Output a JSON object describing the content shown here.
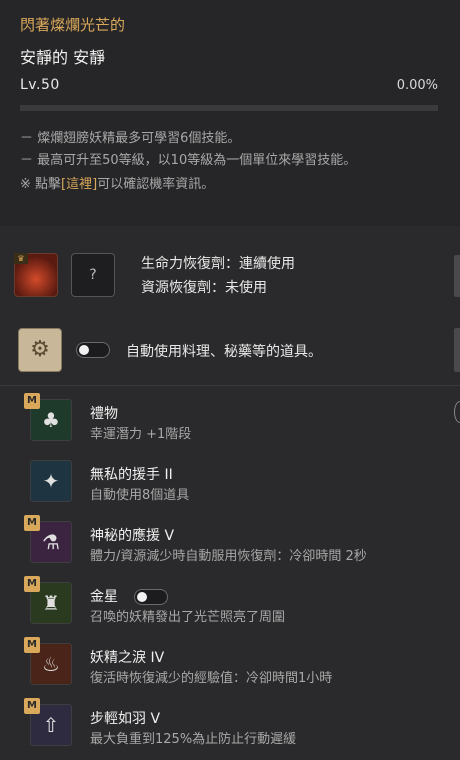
{
  "header": {
    "rank_label": "閃著燦爛光芒的",
    "fairy_name": "安靜的 安靜",
    "level": "Lv.50",
    "exp_percent_text": "0.00%",
    "exp_progress": 0.0
  },
  "info_lines": [
    "－ 燦爛翅膀妖精最多可學習6個技能。",
    "－ 最高可升至50等級，以10等級為一個單位來學習技能。"
  ],
  "info_click": {
    "prefix": "※ 點擊",
    "link": "[這裡]",
    "suffix": "可以確認機率資訊。"
  },
  "potion": {
    "unknown_slot": "?",
    "hp_line": "生命力恢復劑：連續使用",
    "resource_line": "資源恢復劑：未使用"
  },
  "auto_use": {
    "label": "自動使用料理、秘藥等的道具。",
    "enabled": false
  },
  "skills": [
    {
      "badge": "M",
      "icon": "clover-icon",
      "title": "禮物",
      "desc": "幸運潛力 +1階段",
      "color": "#1e3a2a"
    },
    {
      "badge": "",
      "icon": "fairy-icon",
      "title": "無私的援手 II",
      "desc": "自動使用8個道具",
      "color": "#1e3440"
    },
    {
      "badge": "M",
      "icon": "potions-icon",
      "title": "神秘的應援 V",
      "desc": "體力/資源減少時自動服用恢復劑：冷卻時間 2秒",
      "color": "#3a2440"
    },
    {
      "badge": "M",
      "icon": "lantern-icon",
      "title": "金星",
      "desc": "召喚的妖精發出了光芒照亮了周圍",
      "color": "#2a3a1e",
      "toggle": true
    },
    {
      "badge": "M",
      "icon": "tear-vial-icon",
      "title": "妖精之淚 IV",
      "desc": "復活時恢復減少的經驗值：冷卻時間1小時",
      "color": "#4a2418"
    },
    {
      "badge": "M",
      "icon": "weight-up-icon",
      "title": "步輕如羽 V",
      "desc": "最大負重到125%為止防止行動遲緩",
      "color": "#2e2a40"
    }
  ]
}
